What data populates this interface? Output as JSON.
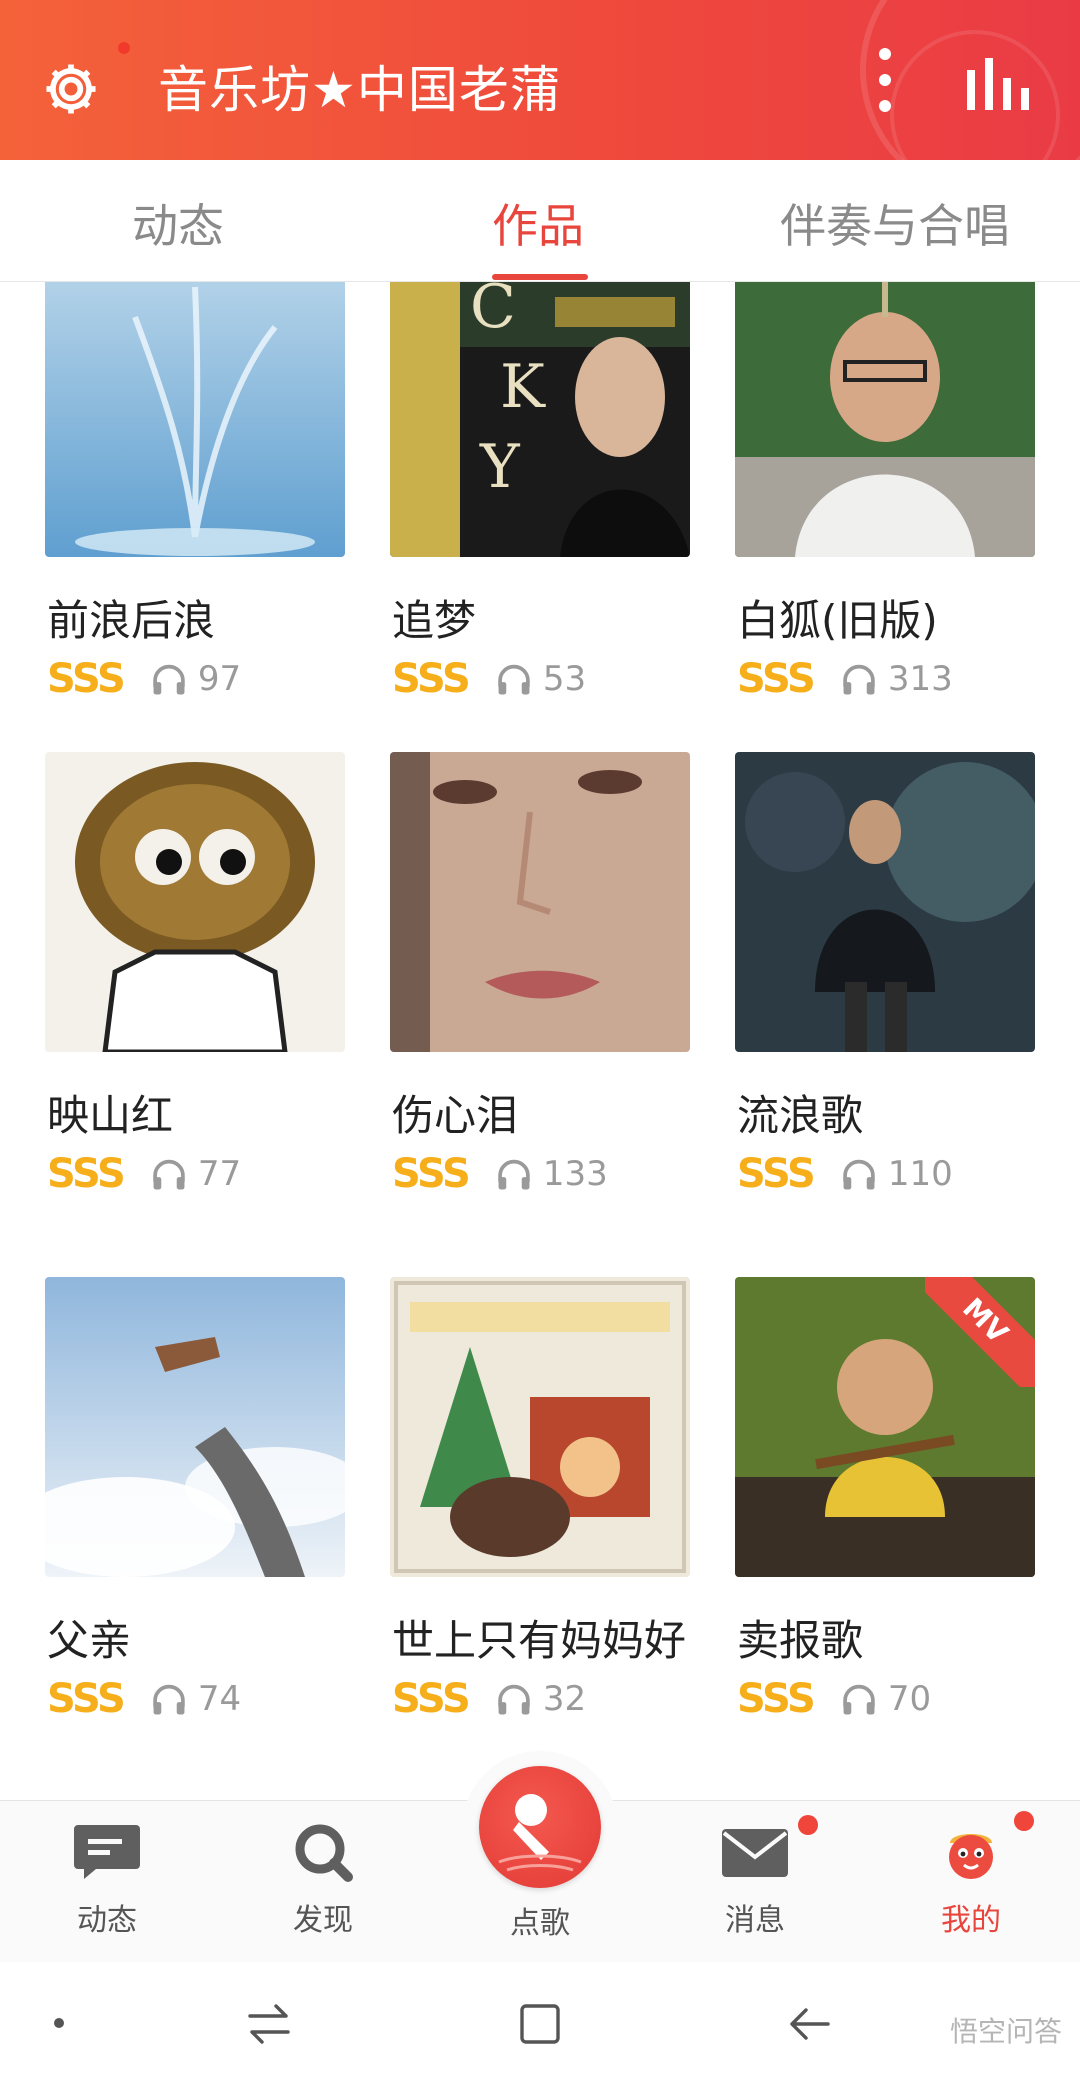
{
  "header": {
    "title": "音乐坊★中国老蒲",
    "settings_icon": "gear-icon",
    "more_icon": "more-vertical-icon",
    "equalizer_icon": "equalizer-icon",
    "accent": "#ef4a3c"
  },
  "tabs": [
    {
      "label": "动态",
      "active": false
    },
    {
      "label": "作品",
      "active": true
    },
    {
      "label": "伴奏与合唱",
      "active": false
    }
  ],
  "works": [
    {
      "title": "前浪后浪",
      "grade": "SSS",
      "plays": "97"
    },
    {
      "title": "追梦",
      "grade": "SSS",
      "plays": "53"
    },
    {
      "title": "白狐(旧版)",
      "grade": "SSS",
      "plays": "313"
    },
    {
      "title": "映山红",
      "grade": "SSS",
      "plays": "77"
    },
    {
      "title": "伤心泪",
      "grade": "SSS",
      "plays": "133"
    },
    {
      "title": "流浪歌",
      "grade": "SSS",
      "plays": "110"
    },
    {
      "title": "父亲",
      "grade": "SSS",
      "plays": "74"
    },
    {
      "title": "世上只有妈妈好",
      "grade": "SSS",
      "plays": "32"
    },
    {
      "title": "卖报歌",
      "grade": "SSS",
      "plays": "70",
      "badge": "MV"
    }
  ],
  "bottom_nav": [
    {
      "label": "动态",
      "icon": "chat-bubble-icon"
    },
    {
      "label": "发现",
      "icon": "search-icon"
    },
    {
      "label": "点歌",
      "icon": "microphone-icon"
    },
    {
      "label": "消息",
      "icon": "mail-icon"
    },
    {
      "label": "我的",
      "icon": "profile-mascot-icon"
    }
  ],
  "watermark": "悟空问答",
  "colors": {
    "grade": "#f6ae1b",
    "active": "#e8453c",
    "badge": "#f0453a"
  }
}
